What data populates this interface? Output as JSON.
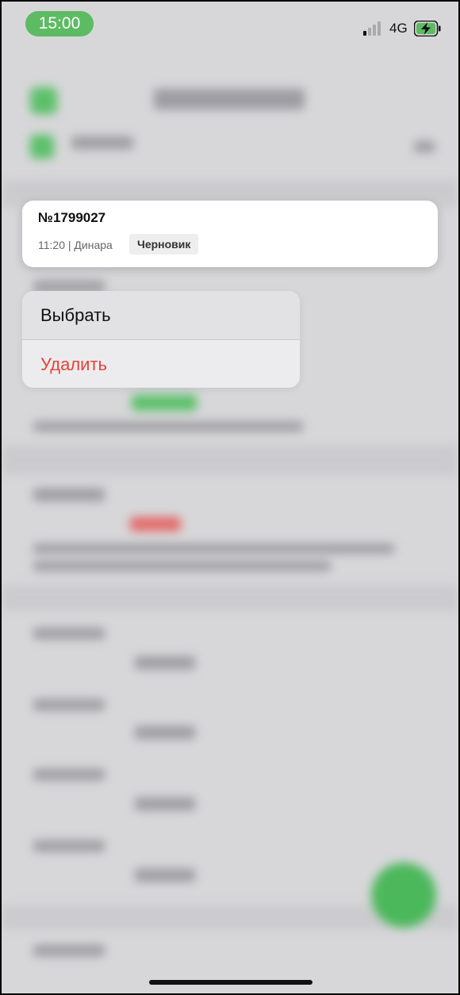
{
  "status_bar": {
    "time": "15:00",
    "network": "4G",
    "time_pill_color": "#5dbb63",
    "battery_state": "charging"
  },
  "preview_card": {
    "number": "№1799027",
    "meta": "11:20 | Динара",
    "badge": "Черновик"
  },
  "context_menu": {
    "select_label": "Выбрать",
    "delete_label": "Удалить",
    "delete_color": "#e3433a"
  },
  "background": {
    "accent": "#4cb85c",
    "fab_icon": "add-icon"
  }
}
